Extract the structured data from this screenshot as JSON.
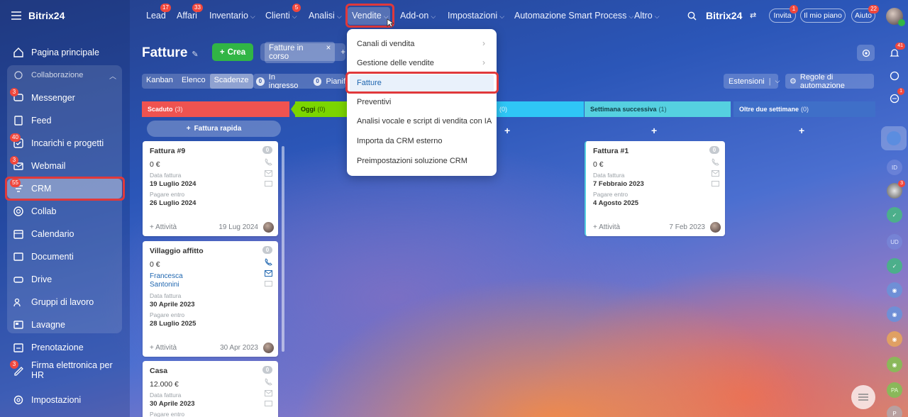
{
  "app": {
    "logo": "Bitrix24",
    "logo_right": "Bitrix24"
  },
  "sidebar": {
    "items": [
      {
        "label": "Pagina principale"
      },
      {
        "label": "Collaborazione"
      },
      {
        "label": "Messenger",
        "badge": "3"
      },
      {
        "label": "Feed"
      },
      {
        "label": "Incarichi e progetti",
        "badge": "40"
      },
      {
        "label": "Webmail",
        "badge": "3"
      },
      {
        "label": "CRM",
        "badge": "55"
      },
      {
        "label": "Collab"
      },
      {
        "label": "Calendario"
      },
      {
        "label": "Documenti"
      },
      {
        "label": "Drive"
      },
      {
        "label": "Gruppi di lavoro"
      },
      {
        "label": "Lavagne"
      },
      {
        "label": "Prenotazione"
      },
      {
        "label": "Firma elettronica per HR",
        "badge": "3"
      },
      {
        "label": "Impostazioni"
      }
    ]
  },
  "topnav": {
    "items": [
      {
        "label": "Lead",
        "badge": "17"
      },
      {
        "label": "Affari",
        "badge": "33"
      },
      {
        "label": "Inventario"
      },
      {
        "label": "Clienti",
        "badge": "5"
      },
      {
        "label": "Analisi"
      },
      {
        "label": "Vendite"
      },
      {
        "label": "Add-on"
      },
      {
        "label": "Impostazioni"
      },
      {
        "label": "Automazione Smart Process"
      },
      {
        "label": "Altro"
      }
    ],
    "invite": "Invita",
    "invite_badge": "1",
    "plan": "Il mio piano",
    "help": "Aiuto",
    "help_badge": "22"
  },
  "page": {
    "title": "Fatture",
    "create": "Crea",
    "filter_chip": "Fatture in corso",
    "views": [
      "Kanban",
      "Elenco",
      "Scadenze"
    ],
    "counters": [
      {
        "count": "0",
        "label": "In ingresso"
      },
      {
        "count": "0",
        "label": "Pianif"
      }
    ],
    "extensions": "Estensioni",
    "rules": "Regole di automazione",
    "quick_invoice": "Fattura rapida"
  },
  "columns": [
    {
      "title": "Scaduto",
      "count": "(3)",
      "color": "#ef5350"
    },
    {
      "title": "Oggi",
      "count": "(0)",
      "color": "#7bd500"
    },
    {
      "title": "",
      "count": "(0)",
      "color": "#2fc6f6"
    },
    {
      "title": "Settimana successiva",
      "count": "(1)",
      "color": "#55d0e0"
    },
    {
      "title": "Oltre due settimane",
      "count": "(0)",
      "color": "#3f6fc8"
    }
  ],
  "cards": [
    {
      "title": "Fattura #9",
      "count": "0",
      "amount": "0 €",
      "date_label": "Data fattura",
      "date": "19 Luglio 2024",
      "due_label": "Pagare entro",
      "due": "26 Luglio 2024",
      "activity": "+ Attività",
      "foot_date": "19 Lug 2024"
    },
    {
      "title": "Villaggio affitto",
      "count": "0",
      "amount": "0 €",
      "person": "Francesca Santonini",
      "date_label": "Data fattura",
      "date": "30 Aprile 2023",
      "due_label": "Pagare entro",
      "due": "28 Luglio 2025",
      "activity": "+ Attività",
      "foot_date": "30 Apr 2023"
    },
    {
      "title": "Casa",
      "count": "0",
      "amount": "12.000 €",
      "date_label": "Data fattura",
      "date": "30 Aprile 2023",
      "due_label": "Pagare entro"
    },
    {
      "title": "Fattura #1",
      "count": "0",
      "amount": "0 €",
      "date_label": "Data fattura",
      "date": "7 Febbraio 2023",
      "due_label": "Pagare entro",
      "due": "4 Agosto 2025",
      "activity": "+ Attività",
      "foot_date": "7 Feb 2023"
    }
  ],
  "dropdown": {
    "items": [
      {
        "label": "Canali di vendita"
      },
      {
        "label": "Gestione delle vendite"
      },
      {
        "label": "Fatture"
      },
      {
        "label": "Preventivi"
      },
      {
        "label": "Analisi vocale e script di vendita con IA"
      },
      {
        "label": "Importa da CRM esterno"
      },
      {
        "label": "Preimpostazioni soluzione CRM"
      }
    ]
  },
  "rail": {
    "badges": [
      "41",
      "1",
      "3"
    ],
    "initials": [
      "ID",
      "UD",
      "PA",
      "P"
    ]
  },
  "colors": {
    "accent": "#2067b0",
    "highlight": "#e0393b",
    "create": "#31b545"
  }
}
